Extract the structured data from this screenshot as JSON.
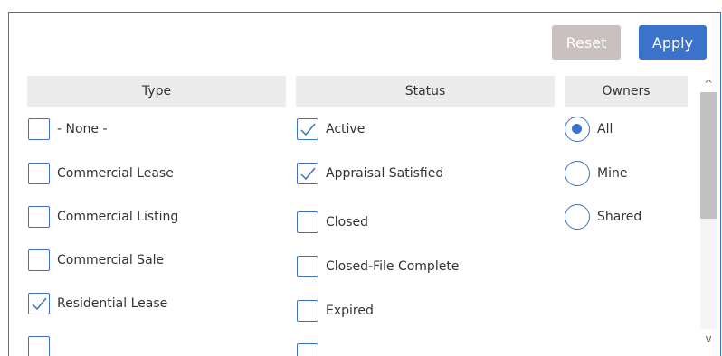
{
  "buttons": {
    "reset": "Reset",
    "apply": "Apply"
  },
  "columns": {
    "type": "Type",
    "status": "Status",
    "owners": "Owners"
  },
  "type_items": [
    {
      "label": "- None -",
      "checked": false
    },
    {
      "label": "Commercial Lease",
      "checked": false
    },
    {
      "label": "Commercial Listing",
      "checked": false
    },
    {
      "label": "Commercial Sale",
      "checked": false
    },
    {
      "label": "Residential Lease",
      "checked": true
    }
  ],
  "status_items": [
    {
      "label": "Active",
      "checked": true
    },
    {
      "label": "Appraisal Satisfied",
      "checked": true
    },
    {
      "label": "Closed",
      "checked": false
    },
    {
      "label": "Closed-File Complete",
      "checked": false
    },
    {
      "label": "Expired",
      "checked": false
    }
  ],
  "owner_items": [
    {
      "label": "All",
      "selected": true
    },
    {
      "label": "Mine",
      "selected": false
    },
    {
      "label": "Shared",
      "selected": false
    }
  ],
  "scrollbar": {
    "up_icon": "chevron-up-icon",
    "down_icon": "chevron-down-icon",
    "up_glyph": "^",
    "down_glyph": "v"
  },
  "colors": {
    "accent": "#3a73c9",
    "border": "#3d72c3",
    "header_bg": "#ececec",
    "reset_bg": "#c9c0bf"
  }
}
